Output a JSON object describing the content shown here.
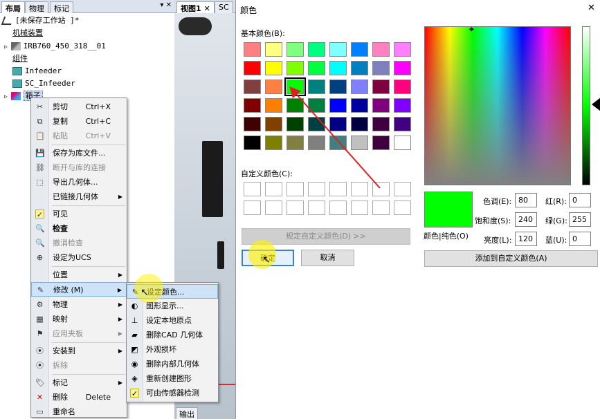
{
  "layout_panel": {
    "tabs": [
      "布局",
      "物理",
      "标记"
    ],
    "tab_controls": "▾ ✕"
  },
  "viewport": {
    "tabs": [
      "视图1 ✕",
      "SC"
    ],
    "output_tab": "输出"
  },
  "tree": {
    "station": "[未保存工作站 ]*",
    "mechanisms_header": "机械装置",
    "robot": "IRB760_450_318__01",
    "components_header": "组件",
    "infeeder": "Infeeder",
    "sc_infeeder": "SC_Infeeder",
    "box": "箱子"
  },
  "context_menu": {
    "items": [
      {
        "label": "剪切",
        "shortcut": "Ctrl+X",
        "icon": "✂"
      },
      {
        "label": "复制",
        "shortcut": "Ctrl+C",
        "icon": "⧉"
      },
      {
        "label": "粘贴",
        "shortcut": "Ctrl+V",
        "icon": "📋"
      },
      {
        "label": "保存为库文件...",
        "icon": "💾"
      },
      {
        "label": "断开与库的连接",
        "icon": "⛓"
      },
      {
        "label": "导出几何体...",
        "icon": "⬚"
      },
      {
        "label": "已链接几何体",
        "icon": ""
      },
      {
        "label": "可见",
        "icon": "✓"
      },
      {
        "label": "检查",
        "icon": "🔍"
      },
      {
        "label": "撤消检查",
        "icon": "🔍"
      },
      {
        "label": "设定为UCS",
        "icon": "⊕"
      },
      {
        "label": "位置",
        "icon": ""
      },
      {
        "label": "修改 (M)",
        "icon": "✎"
      },
      {
        "label": "物理",
        "icon": "⚙"
      },
      {
        "label": "映射",
        "icon": "▦"
      },
      {
        "label": "应用夹板",
        "icon": "⚑"
      },
      {
        "label": "安装到",
        "icon": "⦿"
      },
      {
        "label": "拆除",
        "icon": "⦿"
      },
      {
        "label": "标记",
        "icon": "🏷"
      },
      {
        "label": "删除",
        "shortcut": "Delete",
        "icon": "✕"
      },
      {
        "label": "重命名",
        "icon": "▭"
      }
    ]
  },
  "submenu": {
    "items": [
      {
        "label": "设定颜色...",
        "icon": "✎"
      },
      {
        "label": "图形显示...",
        "icon": "◐"
      },
      {
        "label": "设定本地原点",
        "icon": "⊥"
      },
      {
        "label": "删除CAD 几何体",
        "icon": "▰"
      },
      {
        "label": "外观损坏",
        "icon": "◩"
      },
      {
        "label": "删除内部几何体",
        "icon": "◉"
      },
      {
        "label": "重新创建图形",
        "icon": "◈"
      },
      {
        "label": "可由传感器检测",
        "icon": "✓"
      }
    ]
  },
  "color_dialog": {
    "title": "颜色",
    "close": "✕",
    "basic_colors_label": "基本颜色(B):",
    "custom_colors_label": "自定义颜色(C):",
    "define_custom_button": "规定自定义颜色(D) >>",
    "ok_button": "确定",
    "cancel_button": "取消",
    "add_custom_button": "添加到自定义颜色(A)",
    "preview_label": "颜色|纯色(O)",
    "basic_colors": [
      "#ff8080",
      "#ffff80",
      "#80ff80",
      "#00ff80",
      "#80ffff",
      "#0080ff",
      "#ff80c0",
      "#ff80ff",
      "#ff0000",
      "#ffff00",
      "#80ff00",
      "#00ff40",
      "#00ffff",
      "#0080c0",
      "#8080c0",
      "#ff00ff",
      "#804040",
      "#ff8040",
      "#00ff00",
      "#008080",
      "#004080",
      "#8080ff",
      "#800040",
      "#ff0080",
      "#800000",
      "#ff8000",
      "#008000",
      "#008040",
      "#0000ff",
      "#0000a0",
      "#800080",
      "#8000ff",
      "#400000",
      "#804000",
      "#004000",
      "#004040",
      "#000080",
      "#000040",
      "#400040",
      "#400080",
      "#000000",
      "#808000",
      "#808040",
      "#808080",
      "#408080",
      "#c0c0c0",
      "#400040",
      "#ffffff"
    ],
    "selected_color": "#00ff00",
    "fields": {
      "hue_label": "色调(E):",
      "hue": "80",
      "sat_label": "饱和度(S):",
      "sat": "240",
      "lum_label": "亮度(L):",
      "lum": "120",
      "red_label": "红(R):",
      "red": "0",
      "green_label": "绿(G):",
      "green": "255",
      "blue_label": "蓝(U):",
      "blue": "0"
    }
  }
}
